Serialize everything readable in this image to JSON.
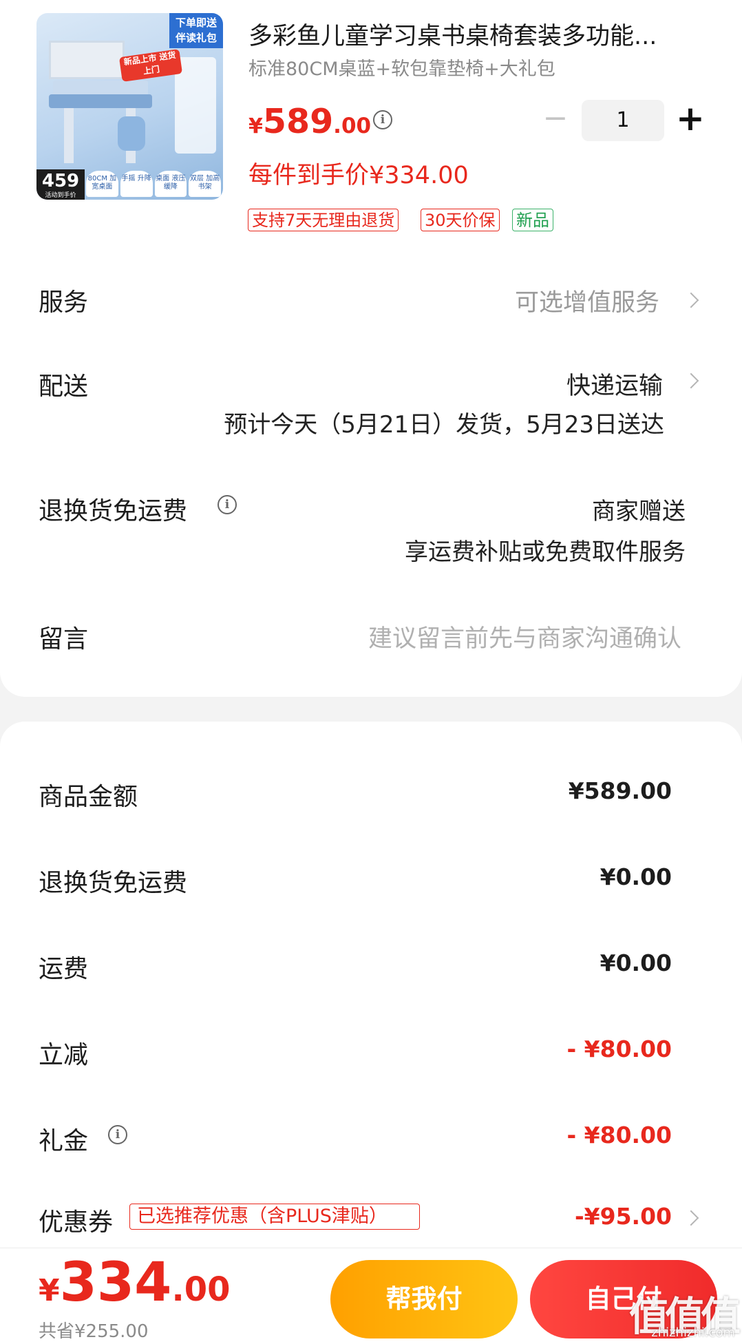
{
  "product": {
    "title": "多彩鱼儿童学习桌书桌椅套装多功能...",
    "spec": "标准80CM桌蓝+软包靠垫椅+大礼包",
    "price_currency": "¥",
    "price_int": "589",
    "price_dec": ".00",
    "quantity": "1",
    "unit_price_text": "每件到手价¥334.00",
    "badges": [
      "支持7天无理由退货",
      "30天价保",
      "新品"
    ],
    "image": {
      "corner_tag": "下单即送 伴读礼包",
      "ribbon": "新品上市 送货上门",
      "price_tag": "459",
      "price_tag_sub": "活动到手价",
      "features": [
        "80CM 加宽桌面",
        "手摇 升降",
        "桌面 液压缓降",
        "双层 加高书架"
      ]
    }
  },
  "options": {
    "service_label": "服务",
    "service_value": "可选增值服务",
    "delivery_label": "配送",
    "delivery_value": "快递运输",
    "delivery_estimate": "预计今天（5月21日）发货，5月23日送达",
    "return_label": "退换货免运费",
    "return_value": "商家赠送",
    "return_detail": "享运费补贴或免费取件服务",
    "message_label": "留言",
    "message_placeholder": "建议留言前先与商家沟通确认"
  },
  "summary": {
    "goods_label": "商品金额",
    "goods_value": "¥589.00",
    "return_label": "退换货免运费",
    "return_value": "¥0.00",
    "shipping_label": "运费",
    "shipping_value": "¥0.00",
    "discount_label": "立减",
    "discount_value": "- ¥80.00",
    "gift_label": "礼金",
    "gift_value": "- ¥80.00",
    "coupon_label": "优惠券",
    "coupon_badge": "已选推荐优惠（含PLUS津贴）",
    "coupon_value": "-¥95.00"
  },
  "footer": {
    "total_currency": "¥",
    "total_int": "334",
    "total_dec": ".00",
    "saved": "共省¥255.00",
    "help_pay": "帮我付",
    "self_pay": "自己付",
    "watermark": "值值值",
    "watermark_sub": "zhizhizhi.com"
  },
  "colors": {
    "price_red": "#e8281d",
    "help_button": "#ffb000",
    "self_button": "#f53535",
    "badge_green": "#23a152"
  }
}
